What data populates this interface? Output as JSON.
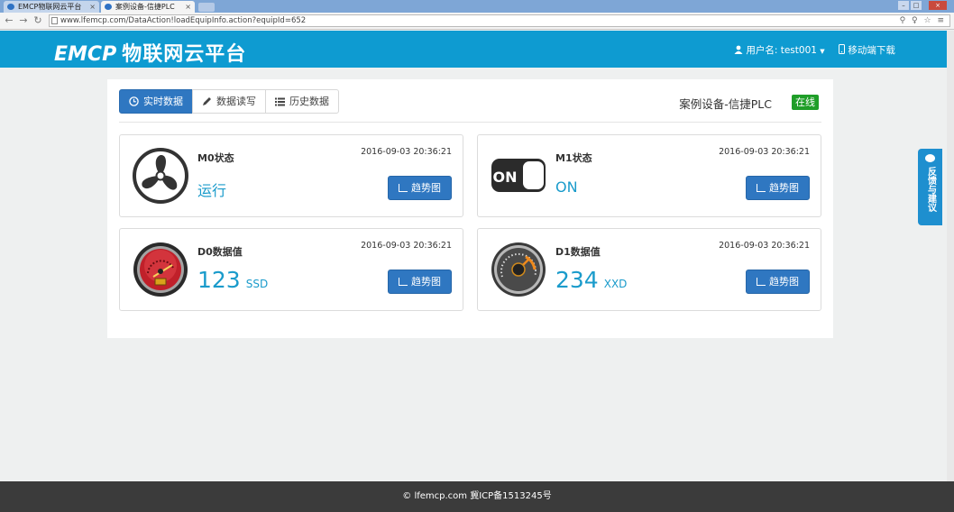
{
  "browser": {
    "tabs": [
      {
        "label": "EMCP物联网云平台",
        "active": false
      },
      {
        "label": "案例设备-信捷PLC",
        "active": true
      }
    ],
    "close_glyph": "×",
    "window_controls": {
      "minimize": "–",
      "maximize": "□",
      "close": "×"
    },
    "nav": {
      "back": "←",
      "forward": "→",
      "reload": "↻"
    },
    "url": "www.lfemcp.com/DataAction!loadEquipInfo.action?equipId=652",
    "url_icons": "⚲ ♀ ☆ ≡"
  },
  "header": {
    "logo_en": "EMCP",
    "logo_cn": "物联网云平台",
    "user_label": "用户名: test001",
    "user_icon": "person-icon",
    "mobile_label": "移动端下载",
    "mobile_icon": "mobile-icon"
  },
  "tabs": [
    {
      "label": "实时数据",
      "icon": "clock-icon",
      "active": true
    },
    {
      "label": "数据读写",
      "icon": "pencil-icon",
      "active": false
    },
    {
      "label": "历史数据",
      "icon": "list-icon",
      "active": false
    }
  ],
  "device": {
    "name": "案例设备-信捷PLC",
    "status": "在线"
  },
  "cards": [
    {
      "label": "M0状态",
      "time": "2016-09-03 20:36:21",
      "value": "运行",
      "unit": "",
      "icon": "fan-icon",
      "button": "趋势图"
    },
    {
      "label": "M1状态",
      "time": "2016-09-03 20:36:21",
      "value": "ON",
      "unit": "",
      "icon": "switch-on-icon",
      "button": "趋势图"
    },
    {
      "label": "D0数据值",
      "time": "2016-09-03 20:36:21",
      "value": "123",
      "unit": "SSD",
      "icon": "red-gauge-icon",
      "button": "趋势图"
    },
    {
      "label": "D1数据值",
      "time": "2016-09-03 20:36:21",
      "value": "234",
      "unit": "XXD",
      "icon": "speedometer-icon",
      "button": "趋势图"
    }
  ],
  "feedback": {
    "label": "反馈与建议"
  },
  "footer": {
    "text": "lfemcp.com 冀ICP备1513245号",
    "icon": "copyright-icon",
    "icon_glyph": "©"
  },
  "colors": {
    "header": "#0e9bd1",
    "primary_button": "#2f77c1",
    "online_badge": "#1f9e28",
    "value_text": "#1a9bcb",
    "footer": "#3b3b3b"
  }
}
